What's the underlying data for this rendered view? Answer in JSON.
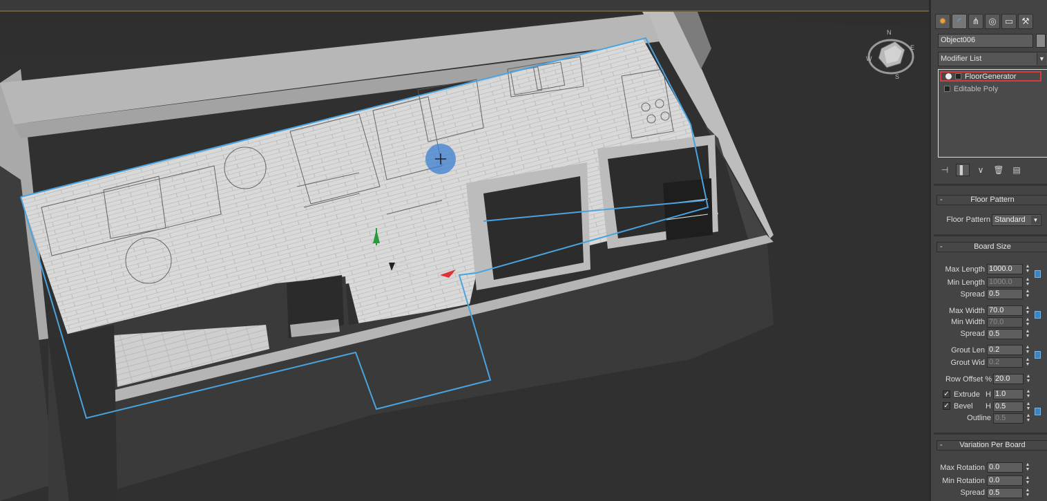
{
  "viewcube": {
    "north": "N",
    "east": "E",
    "south": "S",
    "west": "W"
  },
  "command_panel": {
    "tab_icons": [
      "create-icon",
      "modify-icon",
      "hierarchy-icon",
      "motion-icon",
      "display-icon",
      "utilities-icon"
    ],
    "object_name": "Object006",
    "modifier_list": "Modifier List",
    "stack": [
      {
        "label": "FloorGenerator",
        "selected": true
      },
      {
        "label": "Editable Poly",
        "selected": false
      }
    ],
    "stack_tool_icons": [
      "pin-stack-icon",
      "show-end-result-icon",
      "make-unique-icon",
      "remove-modifier-icon",
      "configure-sets-icon"
    ]
  },
  "rollouts": {
    "floor_pattern": {
      "title": "Floor Pattern",
      "label": "Floor Pattern",
      "value": "Standard"
    },
    "board_size": {
      "title": "Board Size",
      "max_length_label": "Max Length",
      "max_length": "1000.0",
      "min_length_label": "Min Length",
      "min_length": "1000.0",
      "spread1_label": "Spread",
      "spread1": "0.5",
      "max_width_label": "Max Width",
      "max_width": "70.0",
      "min_width_label": "Min Width",
      "min_width": "70.0",
      "spread2_label": "Spread",
      "spread2": "0.5",
      "grout_len_label": "Grout Len",
      "grout_len": "0.2",
      "grout_wid_label": "Grout Wid",
      "grout_wid": "0.2",
      "row_offset_label": "Row Offset %",
      "row_offset": "20.0",
      "extrude_label": "Extrude",
      "extrude_h_label": "H",
      "extrude_h": "1.0",
      "extrude_checked": true,
      "bevel_label": "Bevel",
      "bevel_h_label": "H",
      "bevel_h": "0.5",
      "bevel_checked": true,
      "outline_label": "Outline",
      "outline": "0.5"
    },
    "variation": {
      "title": "Variation Per Board",
      "max_rotation_label": "Max Rotation",
      "max_rotation": "0.0",
      "min_rotation_label": "Min Rotation",
      "min_rotation": "0.0",
      "spread_label": "Spread",
      "spread": "0.5"
    }
  },
  "colors": {
    "selection_outline": "#4aa3e0",
    "highlight_box": "#d93a3a",
    "panel_bg": "#444444",
    "viewport_bg": "#333333"
  }
}
